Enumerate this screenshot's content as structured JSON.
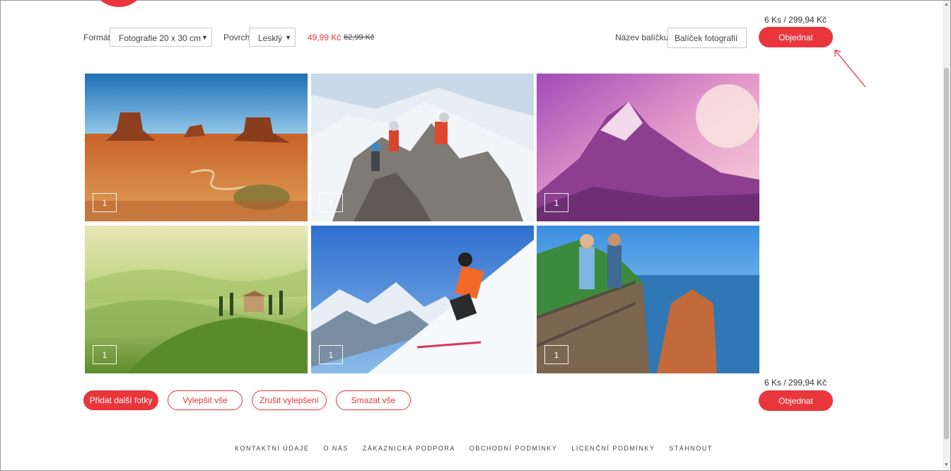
{
  "toolbar": {
    "format_label": "Formát",
    "format_value": "Fotografie 20 x 30 cm",
    "surface_label": "Povrch",
    "surface_value": "Lesklý",
    "price_new": "49,99 Kč",
    "price_old": "62,99 Kč",
    "package_label": "Název balíčku",
    "package_value": "Balíček fotografií"
  },
  "summary_top": "6 Ks / 299,94 Kč",
  "summary_bottom": "6 Ks / 299,94 Kč",
  "order_label": "Objednat",
  "photos": [
    {
      "name": "desert-monument-valley",
      "qty": "1"
    },
    {
      "name": "mountain-climbers",
      "qty": "1"
    },
    {
      "name": "pink-mountain-peak",
      "qty": "1"
    },
    {
      "name": "tuscany-hills",
      "qty": "1"
    },
    {
      "name": "skier-slope",
      "qty": "1"
    },
    {
      "name": "coastal-viewpoint-people",
      "qty": "1"
    }
  ],
  "actions": {
    "add_more": "Přidat další fotky",
    "enhance_all": "Vylepšit vše",
    "cancel_enhance": "Zrušit vylepšení",
    "delete_all": "Smazat vše"
  },
  "footer": {
    "contact": "KONTAKTNÍ ÚDAJE",
    "about": "O NÁS",
    "support": "ZÁKAZNICKÁ PODPORA",
    "terms": "OBCHODNÍ PODMÍNKY",
    "license": "LICENČNÍ PODMÍNKY",
    "download": "STÁHNOUT"
  },
  "colors": {
    "accent": "#e8363c"
  }
}
